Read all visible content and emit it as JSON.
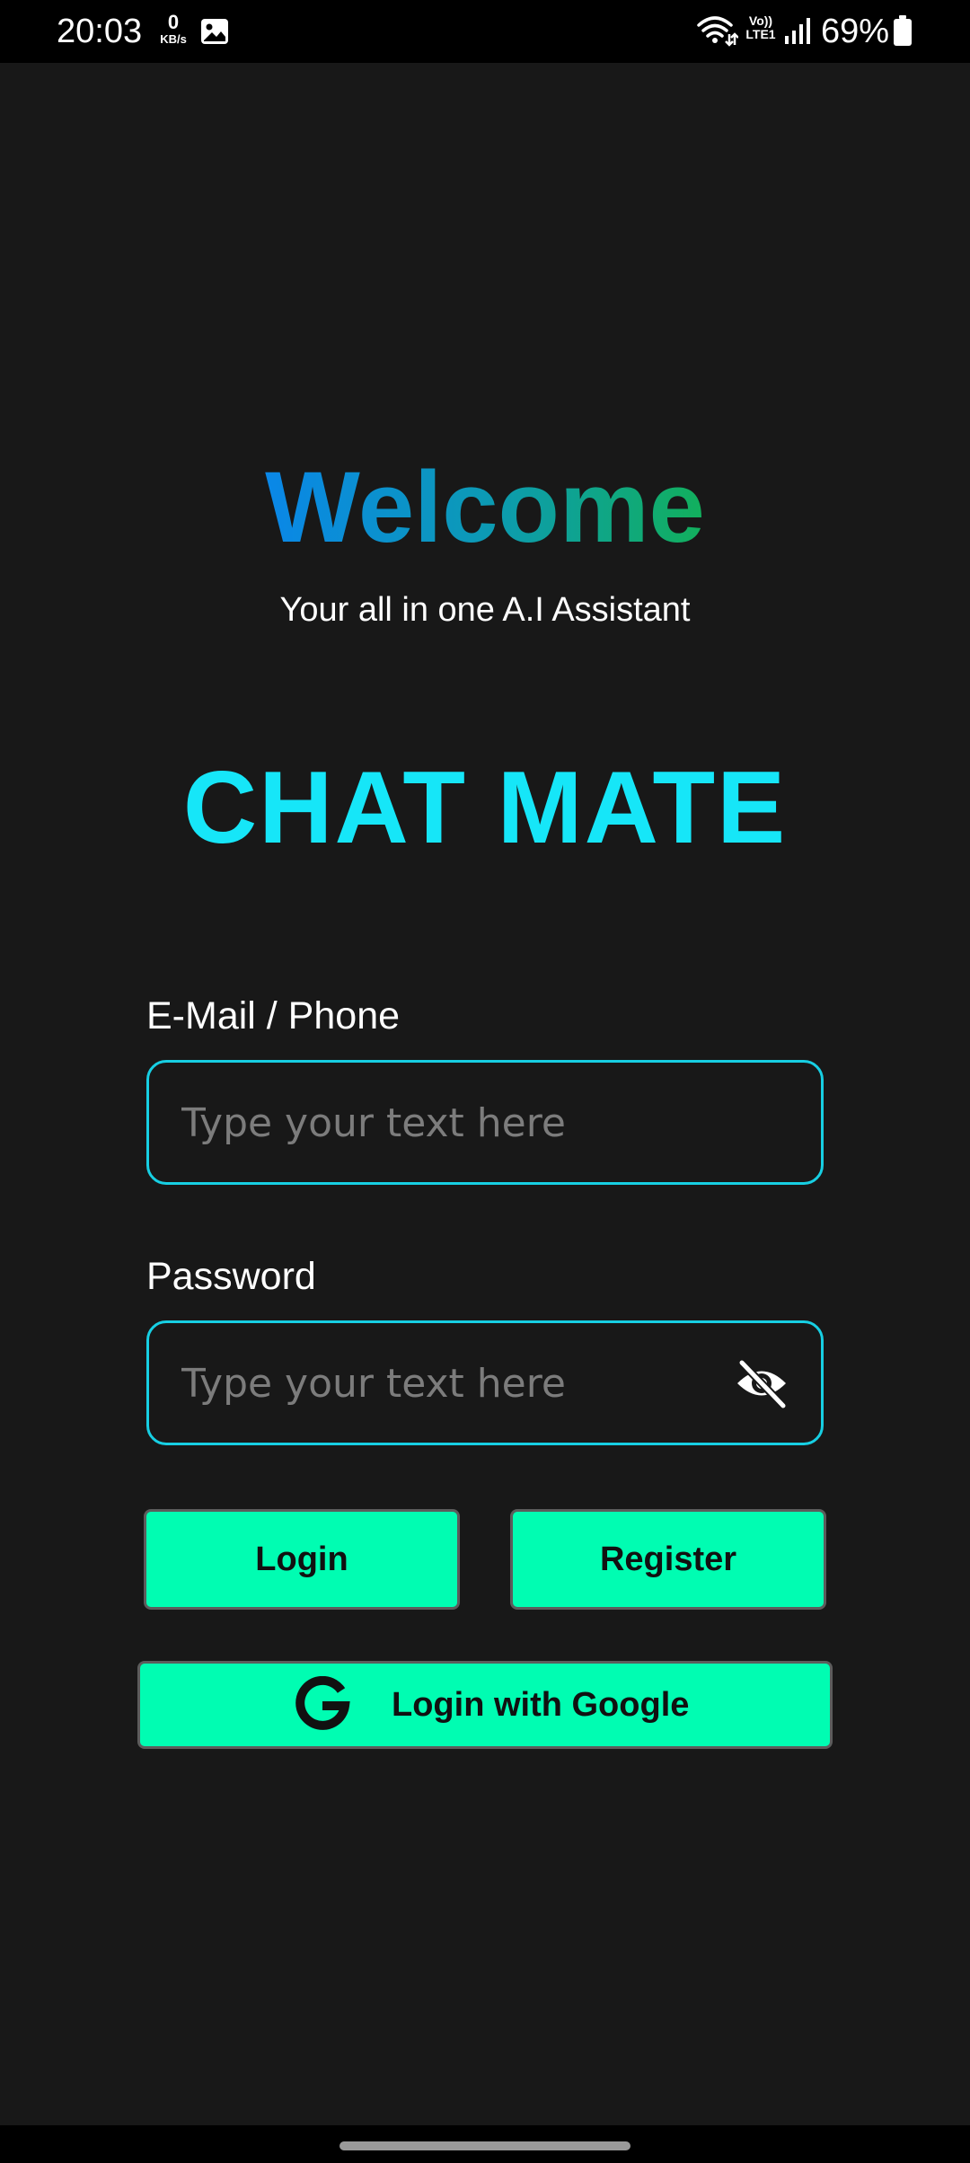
{
  "status_bar": {
    "time": "20:03",
    "net_speed_value": "0",
    "net_speed_unit": "KB/s",
    "volte_top": "Vo))",
    "volte_bottom": "LTE1",
    "battery_percent": "69%",
    "icons": [
      "gallery-icon",
      "wifi-icon",
      "signal-icon",
      "battery-icon"
    ]
  },
  "header": {
    "welcome": "Welcome",
    "subtitle": "Your all in one A.I Assistant",
    "brand": "CHAT MATE"
  },
  "form": {
    "email_label": "E-Mail / Phone",
    "email_placeholder": "Type your text here",
    "password_label": "Password",
    "password_placeholder": "Type your text here",
    "password_toggle_icon": "eye-off-icon"
  },
  "buttons": {
    "login": "Login",
    "register": "Register",
    "google": "Login with Google",
    "google_icon": "google-g-icon"
  },
  "colors": {
    "background": "#181818",
    "accent_cyan": "#16e6f8",
    "field_border": "#17cfe3",
    "button_green": "#00fdb2",
    "welcome_gradient_start": "#0a87e8",
    "welcome_gradient_end": "#12b05c"
  }
}
